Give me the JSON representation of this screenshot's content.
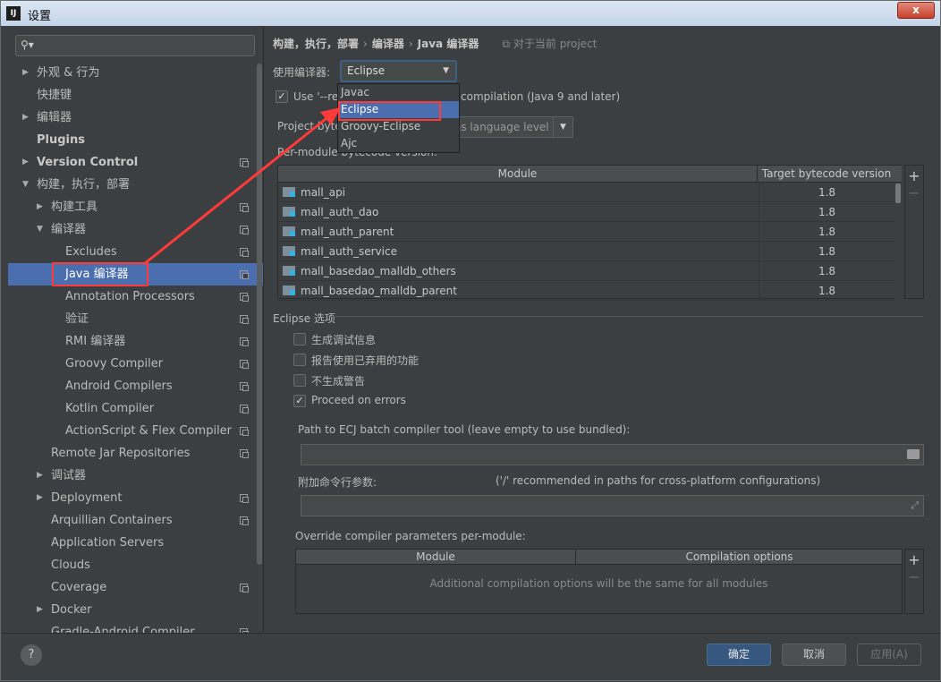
{
  "window": {
    "app_icon": "IJ",
    "title": "设置",
    "close_label": "x"
  },
  "sidebar": {
    "search": {
      "placeholder": ""
    },
    "items": [
      {
        "label": "外观 & 行为",
        "has_arrow": true,
        "expanded": false,
        "indent": 0,
        "copy": false,
        "bold": false
      },
      {
        "label": "快捷键",
        "has_arrow": false,
        "indent": 0,
        "copy": false
      },
      {
        "label": "编辑器",
        "has_arrow": true,
        "expanded": false,
        "indent": 0,
        "copy": false
      },
      {
        "label": "Plugins",
        "has_arrow": false,
        "indent": 0,
        "copy": false,
        "bold": true
      },
      {
        "label": "Version Control",
        "has_arrow": true,
        "expanded": false,
        "indent": 0,
        "copy": true,
        "bold": true
      },
      {
        "label": "构建，执行，部署",
        "has_arrow": true,
        "expanded": true,
        "indent": 0,
        "copy": false
      },
      {
        "label": "构建工具",
        "has_arrow": true,
        "expanded": false,
        "indent": 1,
        "copy": true
      },
      {
        "label": "编译器",
        "has_arrow": true,
        "expanded": true,
        "indent": 1,
        "copy": true
      },
      {
        "label": "Excludes",
        "has_arrow": false,
        "indent": 2,
        "copy": true
      },
      {
        "label": "Java 编译器",
        "has_arrow": false,
        "indent": 2,
        "copy": true,
        "selected": true
      },
      {
        "label": "Annotation Processors",
        "has_arrow": false,
        "indent": 2,
        "copy": true
      },
      {
        "label": "验证",
        "has_arrow": false,
        "indent": 2,
        "copy": true
      },
      {
        "label": "RMI 编译器",
        "has_arrow": false,
        "indent": 2,
        "copy": true
      },
      {
        "label": "Groovy Compiler",
        "has_arrow": false,
        "indent": 2,
        "copy": true
      },
      {
        "label": "Android Compilers",
        "has_arrow": false,
        "indent": 2,
        "copy": true
      },
      {
        "label": "Kotlin Compiler",
        "has_arrow": false,
        "indent": 2,
        "copy": true
      },
      {
        "label": "ActionScript & Flex Compiler",
        "has_arrow": false,
        "indent": 2,
        "copy": true
      },
      {
        "label": "Remote Jar Repositories",
        "has_arrow": false,
        "indent": 1,
        "copy": true
      },
      {
        "label": "调试器",
        "has_arrow": true,
        "expanded": false,
        "indent": 1,
        "copy": false
      },
      {
        "label": "Deployment",
        "has_arrow": true,
        "expanded": false,
        "indent": 1,
        "copy": true
      },
      {
        "label": "Arquillian Containers",
        "has_arrow": false,
        "indent": 1,
        "copy": true
      },
      {
        "label": "Application Servers",
        "has_arrow": false,
        "indent": 1,
        "copy": false
      },
      {
        "label": "Clouds",
        "has_arrow": false,
        "indent": 1,
        "copy": false
      },
      {
        "label": "Coverage",
        "has_arrow": false,
        "indent": 1,
        "copy": true
      },
      {
        "label": "Docker",
        "has_arrow": true,
        "expanded": false,
        "indent": 1,
        "copy": false
      },
      {
        "label": "Gradle-Android Compiler",
        "has_arrow": false,
        "indent": 1,
        "copy": true
      }
    ]
  },
  "main": {
    "breadcrumb": [
      "构建，执行，部署",
      "编译器",
      "Java 编译器"
    ],
    "breadcrumb_sep": "›",
    "scope_label": "对于当前 project",
    "compiler_label": "使用编译器:",
    "compiler_value": "Eclipse",
    "release_option_a": "Use '--re",
    "release_option_b": "compilation (Java 9 and later)",
    "release_checked": "✓",
    "project_bytecode_label": "Project byte",
    "lang_level_value": "as language level",
    "per_module_label": "Per-module bytecode version:",
    "module_table": {
      "headers": [
        "Module",
        "Target bytecode version"
      ],
      "rows": [
        {
          "module": "mall_api",
          "version": "1.8"
        },
        {
          "module": "mall_auth_dao",
          "version": "1.8"
        },
        {
          "module": "mall_auth_parent",
          "version": "1.8"
        },
        {
          "module": "mall_auth_service",
          "version": "1.8"
        },
        {
          "module": "mall_basedao_malldb_others",
          "version": "1.8"
        },
        {
          "module": "mall_basedao_malldb_parent",
          "version": "1.8"
        }
      ],
      "add_button": "+",
      "remove_button": "−"
    },
    "eclipse_section_title": "Eclipse 选项",
    "eclipse_options": [
      {
        "label": "生成调试信息",
        "checked": false
      },
      {
        "label": "报告使用已弃用的功能",
        "checked": false
      },
      {
        "label": "不生成警告",
        "checked": false
      },
      {
        "label": "Proceed on errors",
        "checked": true
      }
    ],
    "ecj_path_label": "Path to ECJ batch compiler tool (leave empty to use bundled):",
    "ecj_path_value": "",
    "args_label": "附加命令行参数:",
    "args_hint": "('/' recommended in paths for cross-platform configurations)",
    "args_value": "",
    "override_label": "Override compiler parameters per-module:",
    "override_table": {
      "headers": [
        "Module",
        "Compilation options"
      ],
      "empty_text": "Additional compilation options will be the same for all modules",
      "add_button": "+",
      "remove_button": "−"
    }
  },
  "dropdown": {
    "options": [
      "Javac",
      "Eclipse",
      "Groovy-Eclipse",
      "Ajc"
    ],
    "highlighted": "Eclipse"
  },
  "annotation": {
    "color": "#ff3a3a"
  },
  "footer": {
    "help": "?",
    "ok": "确定",
    "cancel": "取消",
    "apply": "应用(A)"
  },
  "colors": {
    "background": "#3c3f41",
    "selection": "#4b6eaf",
    "primary_button": "#365880"
  }
}
